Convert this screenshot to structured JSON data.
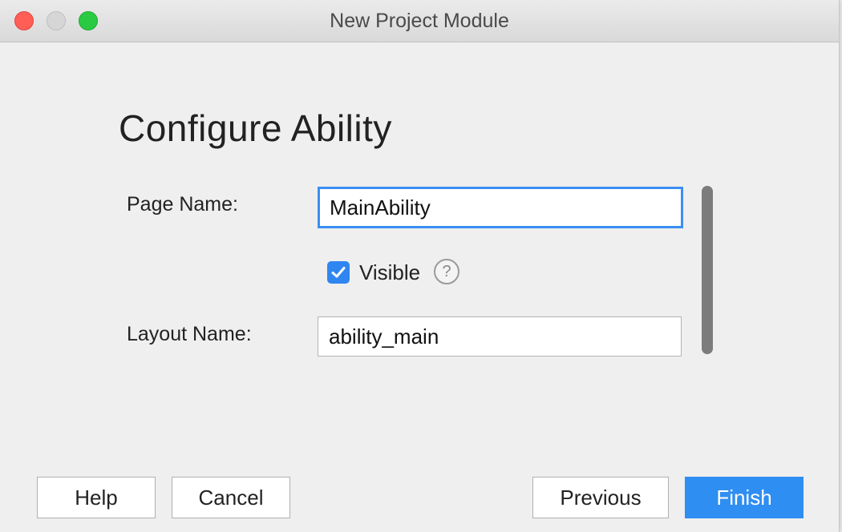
{
  "window": {
    "title": "New Project Module"
  },
  "page": {
    "heading": "Configure Ability"
  },
  "form": {
    "page_name_label": "Page Name:",
    "page_name_value": "MainAbility",
    "visible_label": "Visible",
    "visible_checked": true,
    "help_glyph": "?",
    "layout_name_label": "Layout Name:",
    "layout_name_value": "ability_main"
  },
  "footer": {
    "help_label": "Help",
    "cancel_label": "Cancel",
    "previous_label": "Previous",
    "finish_label": "Finish"
  },
  "colors": {
    "accent": "#2f8ef2",
    "close": "#fd5f57",
    "zoom": "#2acb42"
  },
  "icons": {
    "checkbox": "check-icon",
    "help": "question-circle-icon"
  }
}
